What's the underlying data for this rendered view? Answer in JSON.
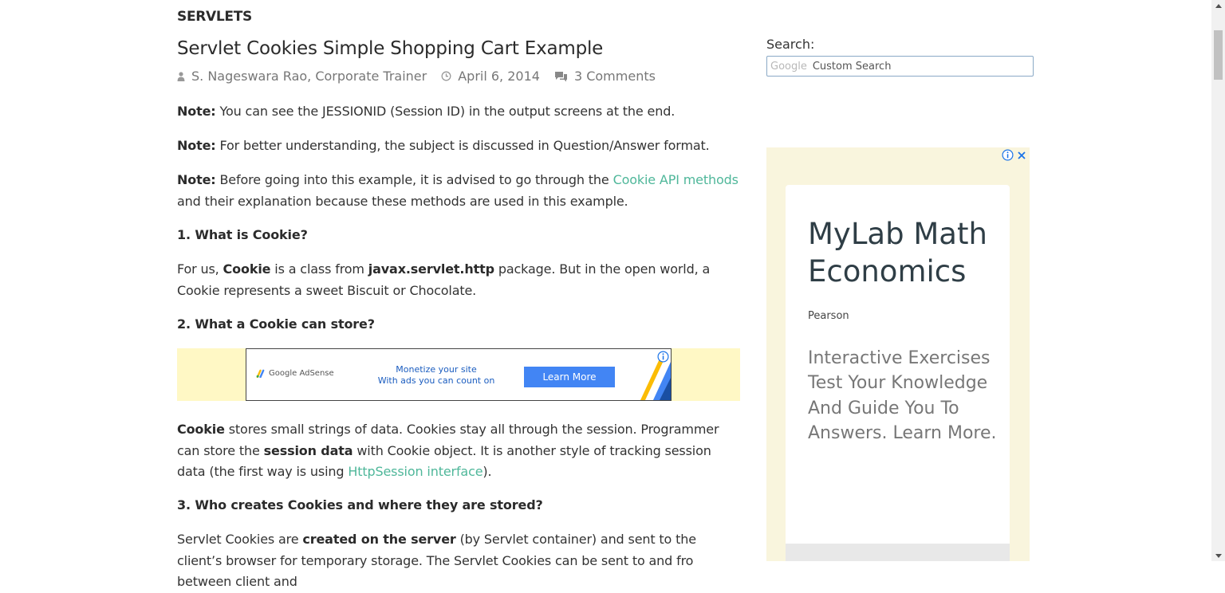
{
  "article": {
    "category": "SERVLETS",
    "title": "Servlet Cookies Simple Shopping Cart Example",
    "meta": {
      "author": "S. Nageswara Rao, Corporate Trainer",
      "date": "April 6, 2014",
      "comments": "3 Comments"
    },
    "note_label": "Note:",
    "note1": " You can see the JESSIONID (Session ID) in the output screens at the end.",
    "note2": " For better understanding, the subject is discussed in Question/Answer format.",
    "note3_before": " Before going into this example, it is advised to go through the ",
    "note3_link": "Cookie API methods",
    "note3_after": " and their explanation because these methods are used in this example.",
    "q1": "1. What is Cookie?",
    "a1": {
      "t1": "For us, ",
      "b1": "Cookie",
      "t2": " is a class from ",
      "b2": "javax.servlet.http",
      "t3": " package. But in the open world, a Cookie represents a sweet Biscuit or Chocolate."
    },
    "q2": "2. What a Cookie can store?",
    "a2": {
      "b1": "Cookie",
      "t1": " stores small strings of data. Cookies stay all through the session. Programmer can store the ",
      "b2": "session data",
      "t2": " with Cookie object. It is another style of tracking session data (the first way is using ",
      "link": "HttpSession interface",
      "t3": ")."
    },
    "q3": "3. Who creates Cookies and where they are stored?",
    "a3": {
      "t1": "Servlet Cookies are ",
      "b1": "created on the server",
      "t2": " (by Servlet container) and sent to the client’s browser for temporary storage. The Servlet Cookies can be sent to and fro between client and"
    }
  },
  "banner_ad": {
    "logo_text": "Google AdSense",
    "line1": "Monetize your site",
    "line2": "With ads you can count on",
    "button": "Learn More"
  },
  "sidebar": {
    "search_label": "Search:",
    "search_google": "Google",
    "search_placeholder": "Custom Search"
  },
  "side_ad": {
    "title": "MyLab Math Economics",
    "brand": "Pearson",
    "description": "Interactive Exercises Test Your Knowledge And Guide You To Answers. Learn More."
  },
  "colors": {
    "link": "#4fb79a",
    "banner_bg": "#fff8c5",
    "side_ad_bg": "#f9f5dd",
    "adsense_button": "#4285f4"
  }
}
